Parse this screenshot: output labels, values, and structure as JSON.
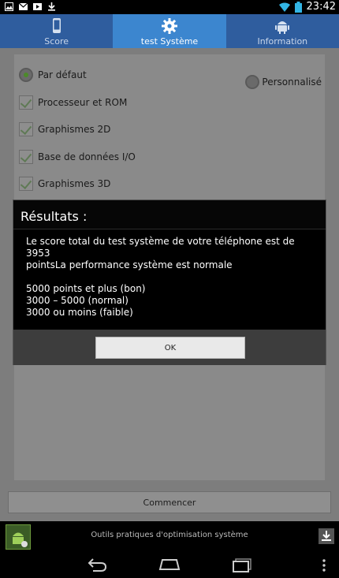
{
  "status_bar": {
    "time": "23:42",
    "icons": [
      "image-icon",
      "gmail-icon",
      "video-icon",
      "download-icon",
      "wifi-icon",
      "battery-icon"
    ]
  },
  "tabs": [
    {
      "label": "Score",
      "icon": "phone-icon",
      "active": false
    },
    {
      "label": "test Système",
      "icon": "gear-icon",
      "active": true
    },
    {
      "label": "Information",
      "icon": "android-icon",
      "active": false
    }
  ],
  "options": {
    "default_label": "Par défaut",
    "custom_label": "Personnalisé",
    "checks": [
      "Processeur et ROM",
      "Graphismes 2D",
      "Base de données I/O",
      "Graphismes 3D"
    ]
  },
  "start_button": "Commencer",
  "ad": {
    "text": "Outils pratiques d'optimisation système"
  },
  "dialog": {
    "title": "Résultats :",
    "line1": "Le score total du test système de votre téléphone est de 3953",
    "line2": "pointsLa performance système est normale",
    "range_good": "5000 points et plus (bon)",
    "range_normal": "3000 – 5000 (normal)",
    "range_weak": "3000 ou moins (faible)",
    "ok": "OK"
  },
  "colors": {
    "tab_bar": "#2f5d9e",
    "tab_active": "#3c86cf"
  }
}
